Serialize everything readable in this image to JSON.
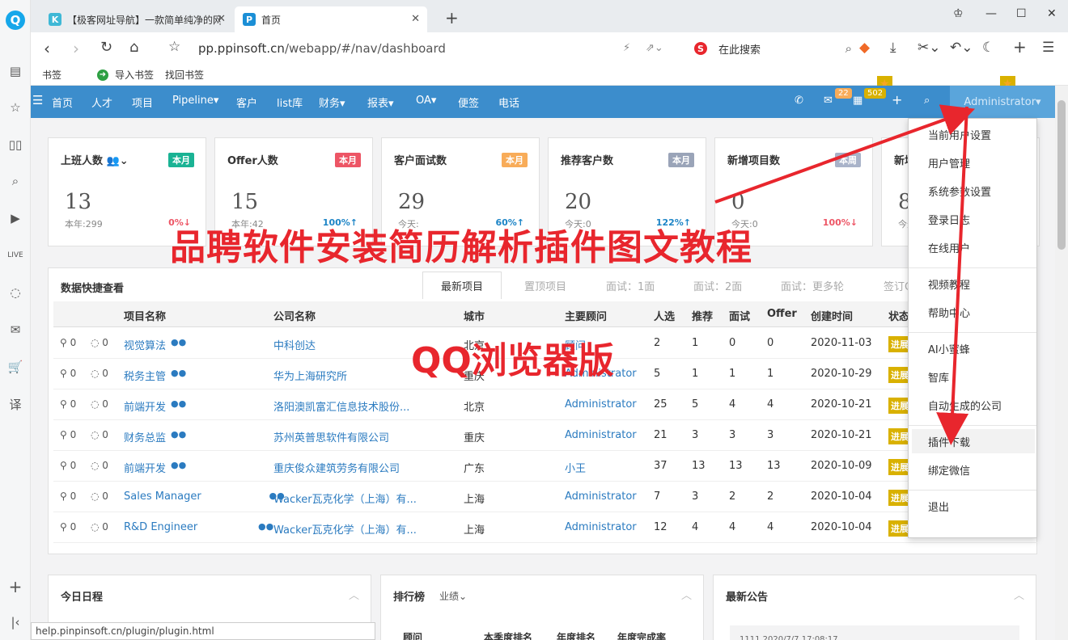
{
  "browser": {
    "tabs": [
      {
        "label": "【极客网址导航】一款简单纯净的网址导航",
        "favicon": "K",
        "color": "#3fb8d6"
      },
      {
        "label": "首页",
        "favicon": "P",
        "color": "#1b8fd6"
      }
    ],
    "url_host": "pp.ppinsoft.cn",
    "url_path": "/webapp/#/nav/dashboard",
    "search_placeholder": "在此搜索",
    "bookmarks": [
      "书签",
      "导入书签",
      "找回书签"
    ],
    "status_url": "help.pinpinsoft.cn/plugin/plugin.html"
  },
  "nav": {
    "items": [
      "首页",
      "人才",
      "项目",
      "Pipeline▾",
      "客户",
      "list库",
      "财务▾",
      "报表▾",
      "OA▾",
      "便签",
      "电话"
    ],
    "mail_count": "22",
    "cal_count": "502",
    "user": "Administrator▾"
  },
  "cards": [
    {
      "title": "上班人数 👥⌄",
      "badge": "本月",
      "color": "#1ab394",
      "value": "13",
      "sub": "本年:299",
      "pct": "0%↓",
      "pctc": "#ed5565"
    },
    {
      "title": "Offer人数",
      "badge": "本月",
      "color": "#ed5565",
      "value": "15",
      "sub": "本年:42",
      "pct": "100%↑",
      "pctc": "#1c84c6"
    },
    {
      "title": "客户面试数",
      "badge": "本月",
      "color": "#f8ac59",
      "value": "29",
      "sub": "今天:",
      "pct": "60%↑",
      "pctc": "#1c84c6"
    },
    {
      "title": "推荐客户数",
      "badge": "本月",
      "color": "#9aa4b8",
      "value": "20",
      "sub": "今天:0",
      "pct": "122%↑",
      "pctc": "#1c84c6"
    },
    {
      "title": "新增项目数",
      "badge": "本周",
      "color": "#a9b3c9",
      "value": "0",
      "sub": "今天:0",
      "pct": "100%↓",
      "pctc": "#ed5565"
    },
    {
      "title": "新增",
      "badge": "",
      "color": "#ccc",
      "value": "8",
      "sub": "今天",
      "pct": "",
      "pctc": "#333"
    }
  ],
  "quick": {
    "title": "数据快捷查看",
    "tabs": [
      "最新项目",
      "置顶项目",
      "面试：1面",
      "面试：2面",
      "面试：更多轮",
      "签订C"
    ],
    "headers": [
      "项目名称",
      "公司名称",
      "城市",
      "主要顾问",
      "人选",
      "推荐",
      "面试",
      "Offer",
      "创建时间",
      "状态"
    ],
    "rows": [
      {
        "att": "0",
        "cmt": "0",
        "name": "视觉算法",
        "company": "中科创达",
        "city": "北京",
        "owner": "顾问",
        "cand": "2",
        "rec": "1",
        "inter": "0",
        "offer": "0",
        "date": "2020-11-03",
        "status": "进展"
      },
      {
        "att": "0",
        "cmt": "0",
        "name": "税务主管",
        "company": "华为上海研究所",
        "city": "重庆",
        "owner": "Administrator",
        "cand": "5",
        "rec": "1",
        "inter": "1",
        "offer": "1",
        "date": "2020-10-29",
        "status": "进展"
      },
      {
        "att": "0",
        "cmt": "0",
        "name": "前端开发",
        "company": "洛阳澳凯富汇信息技术股份...",
        "city": "北京",
        "owner": "Administrator",
        "cand": "25",
        "rec": "5",
        "inter": "4",
        "offer": "4",
        "date": "2020-10-21",
        "status": "进展"
      },
      {
        "att": "0",
        "cmt": "0",
        "name": "财务总监",
        "company": "苏州英普思软件有限公司",
        "city": "重庆",
        "owner": "Administrator",
        "cand": "21",
        "rec": "3",
        "inter": "3",
        "offer": "3",
        "date": "2020-10-21",
        "status": "进展"
      },
      {
        "att": "0",
        "cmt": "0",
        "name": "前端开发",
        "company": "重庆俊众建筑劳务有限公司",
        "city": "广东",
        "owner": "小王",
        "cand": "37",
        "rec": "13",
        "inter": "13",
        "offer": "13",
        "date": "2020-10-09",
        "status": "进展"
      },
      {
        "att": "0",
        "cmt": "0",
        "name": "Sales Manager",
        "company": "Wacker瓦克化学（上海）有...",
        "city": "上海",
        "owner": "Administrator",
        "cand": "7",
        "rec": "3",
        "inter": "2",
        "offer": "2",
        "date": "2020-10-04",
        "status": "进展"
      },
      {
        "att": "0",
        "cmt": "0",
        "name": "R&D Engineer",
        "company": "Wacker瓦克化学（上海）有...",
        "city": "上海",
        "owner": "Administrator",
        "cand": "12",
        "rec": "4",
        "inter": "4",
        "offer": "4",
        "date": "2020-10-04",
        "status": "进展"
      }
    ]
  },
  "panels": {
    "schedule": "今日日程",
    "rank": "排行榜",
    "rank_sel": "业绩⌄",
    "rank_headers": [
      "顾问",
      "本季度排名",
      "年度排名",
      "年度完成率"
    ],
    "notice": "最新公告",
    "notice_item": "1111 2020/7/7 17:08:17"
  },
  "menu": {
    "groups": [
      [
        "当前用户设置",
        "用户管理",
        "系统参数设置",
        "登录日志",
        "在线用户"
      ],
      [
        "视频教程",
        "帮助中心"
      ],
      [
        "AI小蜜蜂",
        "智库",
        "自动生成的公司"
      ],
      [
        "插件下载",
        "绑定微信"
      ],
      [
        "退出"
      ]
    ],
    "highlight": "插件下载"
  },
  "overlay": {
    "headline": "品聘软件安装简历解析插件图文教程",
    "sub": "QQ浏览器版"
  }
}
